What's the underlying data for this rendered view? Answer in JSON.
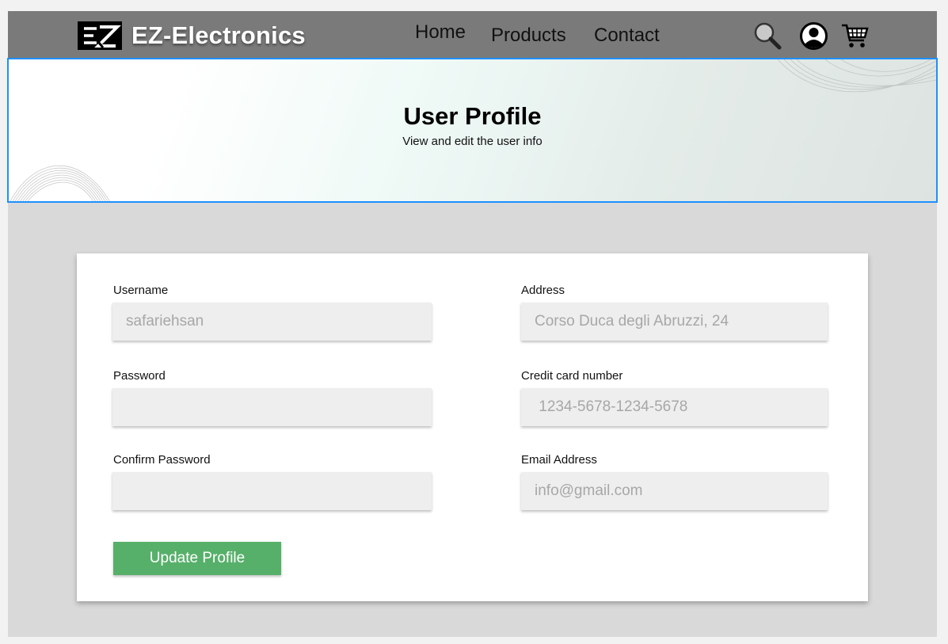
{
  "header": {
    "brand": "EZ-Electronics",
    "logo_icon": "ez-logo",
    "nav": {
      "home": "Home",
      "products": "Products",
      "contact": "Contact"
    },
    "icons": [
      "search-icon",
      "user-icon",
      "cart-icon"
    ]
  },
  "hero": {
    "title": "User Profile",
    "subtitle": "View and edit the user info"
  },
  "form": {
    "username": {
      "label": "Username",
      "placeholder": "safariehsan"
    },
    "password": {
      "label": "Password",
      "placeholder": ""
    },
    "confirm_password": {
      "label": "Confirm Password",
      "placeholder": ""
    },
    "address": {
      "label": "Address",
      "placeholder": "Corso Duca degli Abruzzi, 24"
    },
    "credit_card": {
      "label": "Credit card number",
      "placeholder": " 1234-5678-1234-5678"
    },
    "email": {
      "label": "Email Address",
      "placeholder": "info@gmail.com"
    },
    "submit_label": "Update Profile"
  },
  "colors": {
    "navbar": "#7a7a7a",
    "hero_border": "#1e90ff",
    "button": "#57b06a",
    "input_bg": "#eeeeee"
  }
}
